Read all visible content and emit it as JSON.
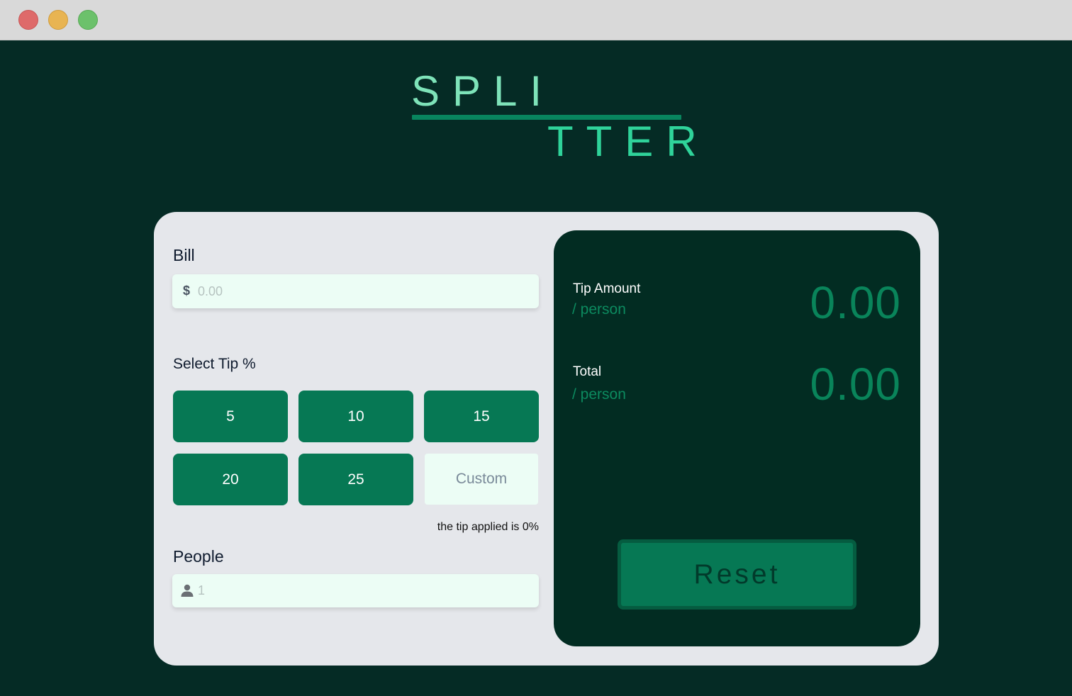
{
  "window": {
    "controls": [
      "close",
      "minimize",
      "maximize"
    ]
  },
  "logo": {
    "top_text": "SPLI",
    "bottom_text": "TTER"
  },
  "bill": {
    "label": "Bill",
    "currency_symbol": "$",
    "placeholder": "0.00",
    "value": ""
  },
  "tip": {
    "label": "Select Tip %",
    "options": [
      "5",
      "10",
      "15",
      "20",
      "25"
    ],
    "custom_placeholder": "Custom",
    "note": "the tip applied is 0%"
  },
  "people": {
    "label": "People",
    "placeholder": "1",
    "value": "",
    "icon": "person-icon"
  },
  "result": {
    "tip_amount": {
      "title": "Tip Amount",
      "sub": "/ person",
      "value": "0.00"
    },
    "total": {
      "title": "Total",
      "sub": "/ person",
      "value": "0.00"
    },
    "reset_label": "Reset"
  },
  "colors": {
    "background": "#052b25",
    "card": "#e5e7eb",
    "panel": "#022c22",
    "accent": "#067854",
    "value": "#09845a"
  }
}
